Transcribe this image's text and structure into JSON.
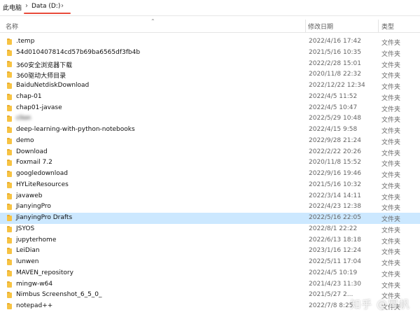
{
  "breadcrumb": {
    "items": [
      "此电脑",
      "Data (D:)"
    ]
  },
  "header": {
    "name": "名称",
    "date": "修改日期",
    "type": "类型"
  },
  "files": [
    {
      "name": ".temp",
      "date": "2022/4/16 17:42",
      "type": "文件夹"
    },
    {
      "name": "54d010407814cd57b69ba6565df3fb4b",
      "date": "2021/5/16 10:35",
      "type": "文件夹"
    },
    {
      "name": "360安全浏览器下载",
      "date": "2022/2/28 15:01",
      "type": "文件夹"
    },
    {
      "name": "360驱动大师目录",
      "date": "2020/11/8 22:32",
      "type": "文件夹"
    },
    {
      "name": "BaiduNetdiskDownload",
      "date": "2022/12/22 12:34",
      "type": "文件夹"
    },
    {
      "name": "chap-01",
      "date": "2022/4/5 11:52",
      "type": "文件夹"
    },
    {
      "name": "chap01-javase",
      "date": "2022/4/5 10:47",
      "type": "文件夹"
    },
    {
      "name": "clion",
      "date": "2022/5/29 10:48",
      "type": "文件夹",
      "blur": true
    },
    {
      "name": "deep-learning-with-python-notebooks",
      "date": "2022/4/15 9:58",
      "type": "文件夹"
    },
    {
      "name": "demo",
      "date": "2022/9/28 21:24",
      "type": "文件夹"
    },
    {
      "name": "Download",
      "date": "2022/2/22 20:26",
      "type": "文件夹"
    },
    {
      "name": "Foxmail 7.2",
      "date": "2020/11/8 15:52",
      "type": "文件夹"
    },
    {
      "name": "googledownload",
      "date": "2022/9/16 19:46",
      "type": "文件夹"
    },
    {
      "name": "HYLiteResources",
      "date": "2021/5/16 10:32",
      "type": "文件夹"
    },
    {
      "name": "javaweb",
      "date": "2022/3/14 14:11",
      "type": "文件夹"
    },
    {
      "name": "JianyingPro",
      "date": "2022/4/23 12:38",
      "type": "文件夹"
    },
    {
      "name": "JianyingPro Drafts",
      "date": "2022/5/16 22:05",
      "type": "文件夹",
      "selected": true
    },
    {
      "name": "JSYOS",
      "date": "2022/8/1 22:22",
      "type": "文件夹"
    },
    {
      "name": "jupyterhome",
      "date": "2022/6/13 18:18",
      "type": "文件夹"
    },
    {
      "name": "LeiDian",
      "date": "2023/1/16 12:24",
      "type": "文件夹"
    },
    {
      "name": "lunwen",
      "date": "2022/5/11 17:04",
      "type": "文件夹"
    },
    {
      "name": "MAVEN_repository",
      "date": "2022/4/5 10:19",
      "type": "文件夹"
    },
    {
      "name": "mingw-w64",
      "date": "2021/4/23 11:30",
      "type": "文件夹"
    },
    {
      "name": "Nimbus Screenshot_6_5_0_",
      "date": "2021/5/27 2...",
      "type": "文件夹"
    },
    {
      "name": "notepad++",
      "date": "2022/7/8 8:25",
      "type": "文件夹"
    }
  ],
  "watermark": "知乎 @冒帆"
}
